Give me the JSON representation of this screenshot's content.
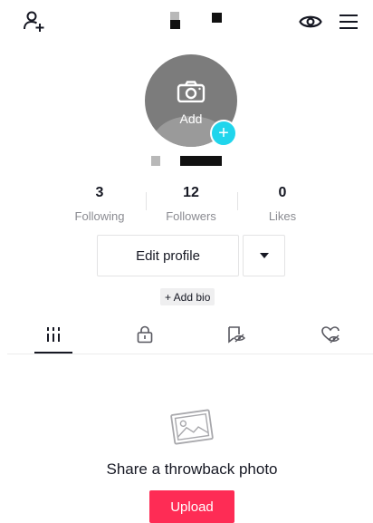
{
  "header": {
    "add_user_icon": "person-plus-icon",
    "eye_icon": "eye-icon",
    "menu_icon": "hamburger-menu-icon"
  },
  "avatar": {
    "camera_icon": "camera-icon",
    "add_label": "Add",
    "plus_label": "+"
  },
  "stats": [
    {
      "value": "3",
      "label": "Following"
    },
    {
      "value": "12",
      "label": "Followers"
    },
    {
      "value": "0",
      "label": "Likes"
    }
  ],
  "actions": {
    "edit_profile": "Edit profile",
    "add_bio": "+ Add bio"
  },
  "tabs": [
    {
      "name": "videos",
      "icon": "grid-icon",
      "active": true
    },
    {
      "name": "private",
      "icon": "lock-icon",
      "active": false
    },
    {
      "name": "reposts-hidden",
      "icon": "hidden-bookmark-icon",
      "active": false
    },
    {
      "name": "liked-hidden",
      "icon": "hidden-heart-icon",
      "active": false
    }
  ],
  "empty_state": {
    "icon": "photo-icon",
    "title": "Share a throwback photo",
    "button": "Upload"
  },
  "colors": {
    "accent_cyan": "#20d5ec",
    "brand_red": "#fe2c55",
    "muted_text": "#8a8b91"
  }
}
